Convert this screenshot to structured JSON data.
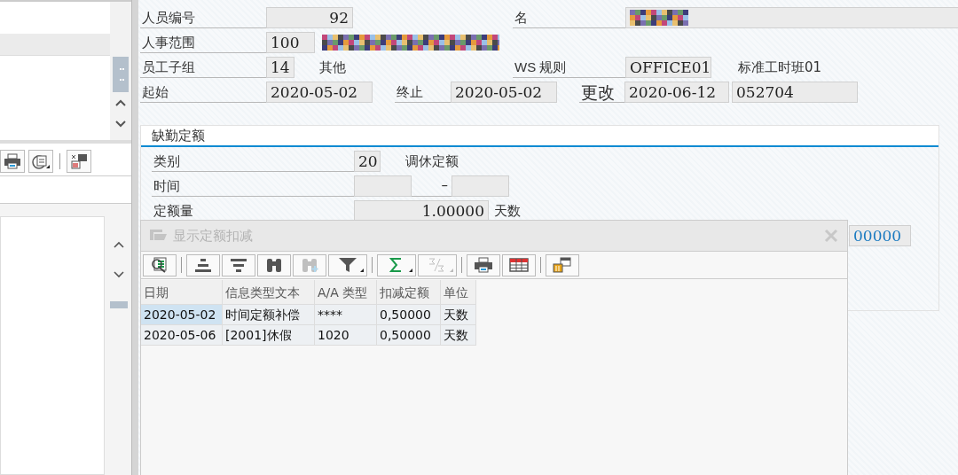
{
  "left_toolbar": [
    {
      "kind": "print",
      "dropdown": false
    },
    {
      "kind": "export",
      "dropdown": true
    },
    {
      "kind": "separator"
    },
    {
      "kind": "layout",
      "dropdown": false
    }
  ],
  "header": {
    "personnel_number": {
      "label": "人员编号",
      "value": "92"
    },
    "name": {
      "label": "名",
      "redacted": true
    },
    "personnel_area": {
      "label": "人事范围",
      "value": "100",
      "redacted": true
    },
    "employee_subgroup": {
      "label": "员工子组",
      "value": "14",
      "text": "其他"
    },
    "ws_rule": {
      "label": "WS 规则",
      "value": "OFFICE01",
      "text": "标准工时班01"
    },
    "start": {
      "label": "起始",
      "value": "2020-05-02"
    },
    "end": {
      "label": "终止",
      "value": "2020-05-02"
    },
    "changed": {
      "label": "更改",
      "value": "2020-06-12",
      "by": "052704"
    }
  },
  "quota": {
    "title": "缺勤定额",
    "category": {
      "label": "类别",
      "value": "20",
      "text": "调休定额"
    },
    "time": {
      "label": "时间",
      "separator": "–"
    },
    "quantity": {
      "label": "定额量",
      "value": "1.00000",
      "unit": "天数"
    },
    "covered_value": "00000"
  },
  "popup": {
    "title": "显示定额扣减",
    "active": false,
    "toolbar": [
      {
        "kind": "details",
        "disabled": false,
        "dropdown": false
      },
      {
        "kind": "separator"
      },
      {
        "kind": "sort-asc",
        "disabled": false,
        "dropdown": false
      },
      {
        "kind": "sort-desc",
        "disabled": false,
        "dropdown": false
      },
      {
        "kind": "find",
        "disabled": false,
        "dropdown": false
      },
      {
        "kind": "find-next",
        "disabled": true,
        "dropdown": false
      },
      {
        "kind": "filter",
        "disabled": false,
        "dropdown": true
      },
      {
        "kind": "separator"
      },
      {
        "kind": "sum",
        "disabled": false,
        "dropdown": true
      },
      {
        "kind": "subtotal",
        "disabled": true,
        "dropdown": true
      },
      {
        "kind": "separator"
      },
      {
        "kind": "print",
        "disabled": false,
        "dropdown": false
      },
      {
        "kind": "grid",
        "disabled": false,
        "dropdown": false
      },
      {
        "kind": "separator"
      },
      {
        "kind": "layout",
        "disabled": false,
        "dropdown": false
      }
    ],
    "columns": [
      "日期",
      "信息类型文本",
      "A/A 类型",
      "扣减定额",
      "单位"
    ],
    "rows": [
      {
        "selected": true,
        "cells": [
          "2020-05-02",
          "时间定额补偿",
          "****",
          "0,50000",
          "天数"
        ]
      },
      {
        "selected": false,
        "cells": [
          "2020-05-06",
          "[2001]休假",
          "1020",
          "0,50000",
          "天数"
        ]
      }
    ]
  }
}
